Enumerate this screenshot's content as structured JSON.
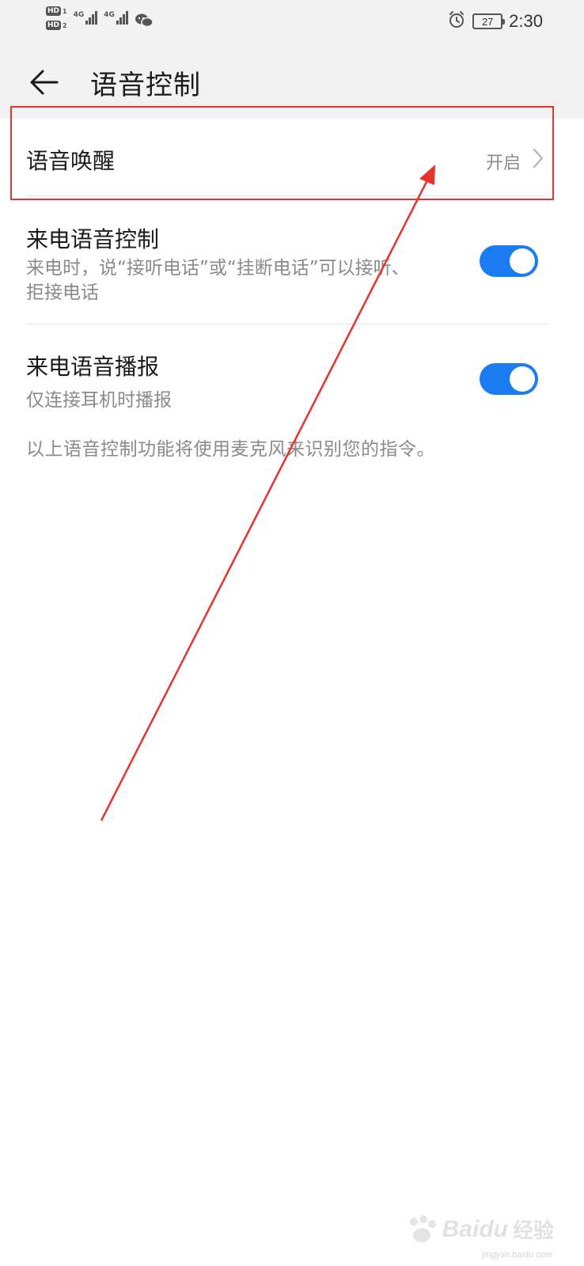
{
  "status_bar": {
    "sim1_label": "HD",
    "sim1_num": "1",
    "sim2_label": "HD",
    "sim2_num": "2",
    "network1": "4G",
    "network2": "4G",
    "battery": "27",
    "time": "2:30",
    "icons": [
      "alarm-icon",
      "wechat-icon",
      "signal-icon"
    ]
  },
  "header": {
    "title": "语音控制",
    "back_icon": "back-arrow-icon"
  },
  "settings": {
    "voice_wake": {
      "label": "语音唤醒",
      "value": "开启"
    },
    "call_voice_control": {
      "label": "来电语音控制",
      "description": "来电时，说“接听电话”或“挂断电话”可以接听、拒接电话",
      "enabled": true
    },
    "call_announce": {
      "label": "来电语音播报",
      "description": "仅连接耳机时播报",
      "enabled": true
    },
    "footnote": "以上语音控制功能将使用麦克风来识别您的指令。"
  },
  "watermark": {
    "logo": "Baidu",
    "text": "经验",
    "url": "jingyan.baidu.com"
  },
  "colors": {
    "accent": "#1b7cf2",
    "annotation": "#e8322c",
    "header_bg": "#f2f2f2"
  }
}
